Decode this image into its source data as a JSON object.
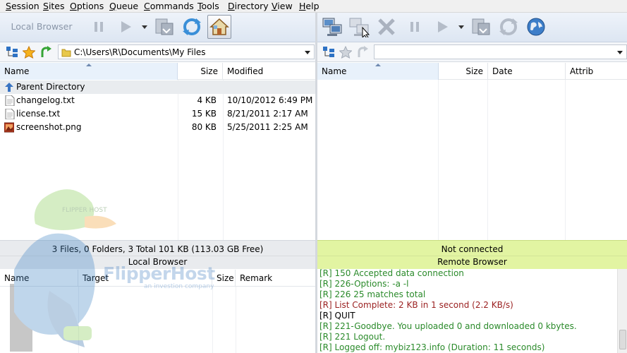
{
  "menu": [
    "Session",
    "Sites",
    "Options",
    "Queue",
    "Commands",
    "Tools",
    "Directory",
    "View",
    "Help"
  ],
  "toolbar_left": {
    "label": "Local Browser"
  },
  "local": {
    "path": "C:\\Users\\R\\Documents\\My Files",
    "columns": [
      "Name",
      "Size",
      "Modified"
    ],
    "parent_label": "Parent Directory",
    "files": [
      {
        "name": "changelog.txt",
        "size": "4 KB",
        "modified": "10/10/2012 6:49 PM",
        "icon": "text-file-icon"
      },
      {
        "name": "license.txt",
        "size": "15 KB",
        "modified": "8/21/2011 2:17 AM",
        "icon": "text-file-icon"
      },
      {
        "name": "screenshot.png",
        "size": "80 KB",
        "modified": "5/25/2011 2:25 AM",
        "icon": "image-file-icon"
      }
    ],
    "status_line1": "3 Files, 0 Folders, 3 Total 101 KB (113.03 GB Free)",
    "status_line2": "Local Browser"
  },
  "remote": {
    "path": "",
    "columns": [
      "Name",
      "Size",
      "Date",
      "Attrib"
    ],
    "status_line1": "Not connected",
    "status_line2": "Remote Browser"
  },
  "queue": {
    "columns": [
      "Name",
      "Target",
      "Size",
      "Remark"
    ]
  },
  "watermark": {
    "text": "FlipperHost",
    "sub": "an investion company",
    "cap_text": "FLIPPER HOST"
  },
  "log": [
    {
      "text": "[R] 150 Accepted data connection",
      "color": "#2a8a2a"
    },
    {
      "text": "[R] 226-Options: -a -l",
      "color": "#2a8a2a"
    },
    {
      "text": "[R] 226 25 matches total",
      "color": "#2a8a2a"
    },
    {
      "text": "[R] List Complete: 2 KB in 1 second (2.2 KB/s)",
      "color": "#9a1f1f"
    },
    {
      "text": "[R] QUIT",
      "color": "#000000"
    },
    {
      "text": "[R] 221-Goodbye. You uploaded 0 and downloaded 0 kbytes.",
      "color": "#2a8a2a"
    },
    {
      "text": "[R] 221 Logout.",
      "color": "#2a8a2a"
    },
    {
      "text": "[R] Logged off: mybiz123.info (Duration: 11 seconds)",
      "color": "#2a8a2a"
    }
  ]
}
